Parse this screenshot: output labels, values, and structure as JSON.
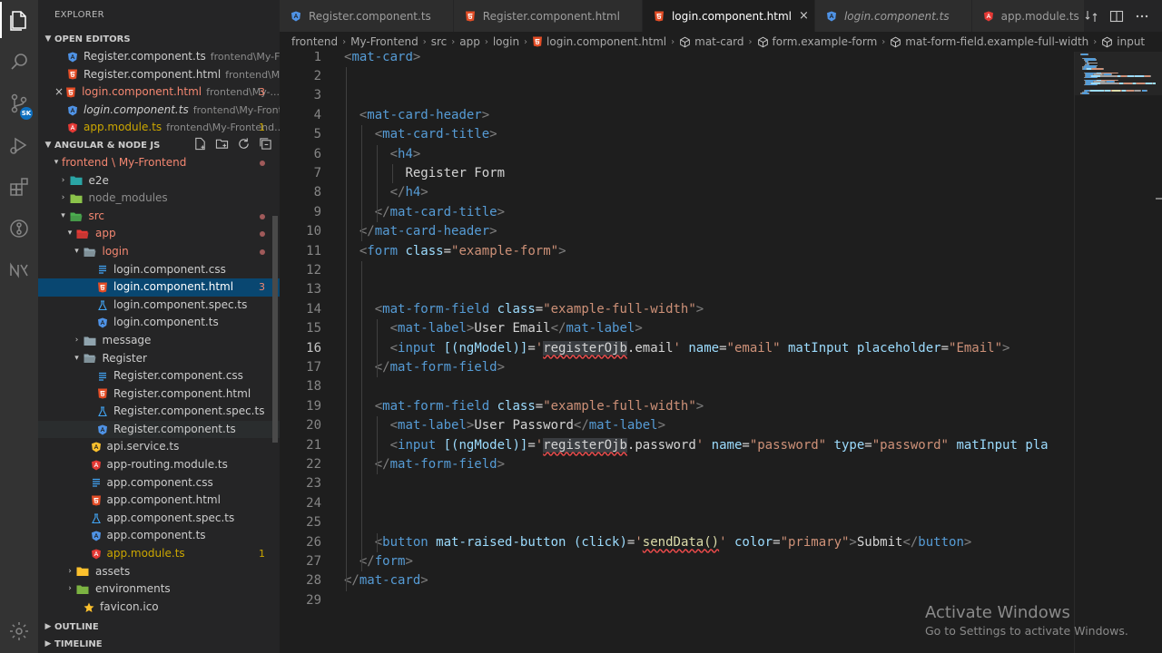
{
  "sidebar": {
    "title": "EXPLORER",
    "open_editors_header": "OPEN EDITORS",
    "open_editors": [
      {
        "name": "Register.component.ts",
        "path": "frontend\\My-Front...",
        "icon": "angular-ts-icon",
        "italic": false
      },
      {
        "name": "Register.component.html",
        "path": "frontend\\My-Fr...",
        "icon": "html-icon",
        "italic": false
      },
      {
        "name": "login.component.html",
        "path": "frontend\\My-...",
        "icon": "html-icon",
        "italic": false,
        "count": "3",
        "error": true
      },
      {
        "name": "login.component.ts",
        "path": "frontend\\My-Frontend...",
        "icon": "angular-ts-icon",
        "italic": true
      },
      {
        "name": "app.module.ts",
        "path": "frontend\\My-Frontend...",
        "icon": "angular-icon",
        "italic": false,
        "count": "1",
        "warn": true
      }
    ],
    "workspace_header": "ANGULAR & NODE JS",
    "outline_header": "OUTLINE",
    "timeline_header": "TIMELINE",
    "tree": [
      {
        "name": "frontend \\ My-Frontend",
        "depth": 0,
        "kind": "folder-open",
        "color": "err",
        "dot": true
      },
      {
        "name": "e2e",
        "depth": 1,
        "kind": "folder",
        "icon_color": "#2aa5a5"
      },
      {
        "name": "node_modules",
        "depth": 1,
        "kind": "folder",
        "icon_color": "#8bc34a",
        "dim": true
      },
      {
        "name": "src",
        "depth": 1,
        "kind": "folder-open",
        "color": "err",
        "dot": true,
        "icon_color": "#4caf50"
      },
      {
        "name": "app",
        "depth": 2,
        "kind": "folder-open",
        "color": "err",
        "dot": true,
        "icon_color": "#e53935"
      },
      {
        "name": "login",
        "depth": 3,
        "kind": "folder-open",
        "color": "err",
        "dot": true,
        "icon_color": "#90a4ae"
      },
      {
        "name": "login.component.css",
        "depth": 4,
        "kind": "css"
      },
      {
        "name": "login.component.html",
        "depth": 4,
        "kind": "html",
        "selected": true,
        "count": "3",
        "color": "err"
      },
      {
        "name": "login.component.spec.ts",
        "depth": 4,
        "kind": "spec"
      },
      {
        "name": "login.component.ts",
        "depth": 4,
        "kind": "angular-ts"
      },
      {
        "name": "message",
        "depth": 3,
        "kind": "folder",
        "icon_color": "#90a4ae"
      },
      {
        "name": "Register",
        "depth": 3,
        "kind": "folder-open",
        "icon_color": "#90a4ae"
      },
      {
        "name": "Register.component.css",
        "depth": 4,
        "kind": "css"
      },
      {
        "name": "Register.component.html",
        "depth": 4,
        "kind": "html"
      },
      {
        "name": "Register.component.spec.ts",
        "depth": 4,
        "kind": "spec"
      },
      {
        "name": "Register.component.ts",
        "depth": 4,
        "kind": "angular-ts",
        "hover": true
      },
      {
        "name": "api.service.ts",
        "depth": 3,
        "kind": "service"
      },
      {
        "name": "app-routing.module.ts",
        "depth": 3,
        "kind": "angular"
      },
      {
        "name": "app.component.css",
        "depth": 3,
        "kind": "css"
      },
      {
        "name": "app.component.html",
        "depth": 3,
        "kind": "html"
      },
      {
        "name": "app.component.spec.ts",
        "depth": 3,
        "kind": "spec"
      },
      {
        "name": "app.component.ts",
        "depth": 3,
        "kind": "angular-ts"
      },
      {
        "name": "app.module.ts",
        "depth": 3,
        "kind": "angular",
        "color": "warn",
        "count": "1"
      },
      {
        "name": "assets",
        "depth": 2,
        "kind": "folder",
        "icon_color": "#fbc02d"
      },
      {
        "name": "environments",
        "depth": 2,
        "kind": "folder",
        "icon_color": "#7cb342"
      },
      {
        "name": "favicon.ico",
        "depth": 2,
        "kind": "favicon"
      }
    ]
  },
  "tabs": [
    {
      "label": "Register.component.ts",
      "icon": "angular-ts-icon",
      "active": false,
      "italic": false
    },
    {
      "label": "Register.component.html",
      "icon": "html-icon",
      "active": false,
      "italic": false
    },
    {
      "label": "login.component.html",
      "icon": "html-icon",
      "active": true,
      "italic": false,
      "close": "×"
    },
    {
      "label": "login.component.ts",
      "icon": "angular-ts-icon",
      "active": false,
      "italic": true
    },
    {
      "label": "app.module.ts",
      "icon": "angular-icon",
      "active": false,
      "italic": false
    }
  ],
  "breadcrumb": [
    "frontend",
    "My-Frontend",
    "src",
    "app",
    "login",
    "login.component.html",
    "mat-card",
    "form.example-form",
    "mat-form-field.example-full-width",
    "input"
  ],
  "editor": {
    "lines": [
      [
        [
          "br",
          "<"
        ],
        [
          "tg",
          "mat-card"
        ],
        [
          "br",
          ">"
        ]
      ],
      [],
      [],
      [
        [
          "sp",
          "  "
        ],
        [
          "br",
          "<"
        ],
        [
          "tg",
          "mat-card-header"
        ],
        [
          "br",
          ">"
        ]
      ],
      [
        [
          "sp",
          "    "
        ],
        [
          "br",
          "<"
        ],
        [
          "tg",
          "mat-card-title"
        ],
        [
          "br",
          ">"
        ]
      ],
      [
        [
          "sp",
          "      "
        ],
        [
          "br",
          "<"
        ],
        [
          "tg",
          "h4"
        ],
        [
          "br",
          ">"
        ]
      ],
      [
        [
          "sp",
          "        "
        ],
        [
          "tx",
          "Register Form"
        ]
      ],
      [
        [
          "sp",
          "      "
        ],
        [
          "br",
          "</"
        ],
        [
          "tg",
          "h4"
        ],
        [
          "br",
          ">"
        ]
      ],
      [
        [
          "sp",
          "    "
        ],
        [
          "br",
          "</"
        ],
        [
          "tg",
          "mat-card-title"
        ],
        [
          "br",
          ">"
        ]
      ],
      [
        [
          "sp",
          "  "
        ],
        [
          "br",
          "</"
        ],
        [
          "tg",
          "mat-card-header"
        ],
        [
          "br",
          ">"
        ]
      ],
      [
        [
          "sp",
          "  "
        ],
        [
          "br",
          "<"
        ],
        [
          "tg",
          "form"
        ],
        [
          "tx",
          " "
        ],
        [
          "at",
          "class"
        ],
        [
          "tx",
          "="
        ],
        [
          "st",
          "\"example-form\""
        ],
        [
          "br",
          ">"
        ]
      ],
      [],
      [],
      [
        [
          "sp",
          "    "
        ],
        [
          "br",
          "<"
        ],
        [
          "tg",
          "mat-form-field"
        ],
        [
          "tx",
          " "
        ],
        [
          "at",
          "class"
        ],
        [
          "tx",
          "="
        ],
        [
          "st",
          "\"example-full-width\""
        ],
        [
          "br",
          ">"
        ]
      ],
      [
        [
          "sp",
          "      "
        ],
        [
          "br",
          "<"
        ],
        [
          "tg",
          "mat-label"
        ],
        [
          "br",
          ">"
        ],
        [
          "tx",
          "User Email"
        ],
        [
          "br",
          "</"
        ],
        [
          "tg",
          "mat-label"
        ],
        [
          "br",
          ">"
        ]
      ],
      [
        [
          "sp",
          "      "
        ],
        [
          "br",
          "<"
        ],
        [
          "tg",
          "input"
        ],
        [
          "tx",
          " "
        ],
        [
          "at",
          "[(ngModel)]"
        ],
        [
          "tx",
          "="
        ],
        [
          "st",
          "'"
        ],
        [
          "sqhl",
          "registerOjb"
        ],
        [
          "tx",
          ".email"
        ],
        [
          "st",
          "'"
        ],
        [
          "tx",
          " "
        ],
        [
          "at",
          "name"
        ],
        [
          "tx",
          "="
        ],
        [
          "st",
          "\"email\""
        ],
        [
          "tx",
          " "
        ],
        [
          "at",
          "matInput"
        ],
        [
          "tx",
          " "
        ],
        [
          "at",
          "placeholder"
        ],
        [
          "tx",
          "="
        ],
        [
          "st",
          "\"Email\""
        ],
        [
          "br",
          ">"
        ]
      ],
      [
        [
          "sp",
          "    "
        ],
        [
          "br",
          "</"
        ],
        [
          "tg",
          "mat-form-field"
        ],
        [
          "br",
          ">"
        ]
      ],
      [],
      [
        [
          "sp",
          "    "
        ],
        [
          "br",
          "<"
        ],
        [
          "tg",
          "mat-form-field"
        ],
        [
          "tx",
          " "
        ],
        [
          "at",
          "class"
        ],
        [
          "tx",
          "="
        ],
        [
          "st",
          "\"example-full-width\""
        ],
        [
          "br",
          ">"
        ]
      ],
      [
        [
          "sp",
          "      "
        ],
        [
          "br",
          "<"
        ],
        [
          "tg",
          "mat-label"
        ],
        [
          "br",
          ">"
        ],
        [
          "tx",
          "User Password"
        ],
        [
          "br",
          "</"
        ],
        [
          "tg",
          "mat-label"
        ],
        [
          "br",
          ">"
        ]
      ],
      [
        [
          "sp",
          "      "
        ],
        [
          "br",
          "<"
        ],
        [
          "tg",
          "input"
        ],
        [
          "tx",
          " "
        ],
        [
          "at",
          "[(ngModel)]"
        ],
        [
          "tx",
          "="
        ],
        [
          "st",
          "'"
        ],
        [
          "sqhl",
          "registerOjb"
        ],
        [
          "tx",
          ".password"
        ],
        [
          "st",
          "'"
        ],
        [
          "tx",
          " "
        ],
        [
          "at",
          "name"
        ],
        [
          "tx",
          "="
        ],
        [
          "st",
          "\"password\""
        ],
        [
          "tx",
          " "
        ],
        [
          "at",
          "type"
        ],
        [
          "tx",
          "="
        ],
        [
          "st",
          "\"password\""
        ],
        [
          "tx",
          " "
        ],
        [
          "at",
          "matInput"
        ],
        [
          "tx",
          " "
        ],
        [
          "at",
          "pla"
        ]
      ],
      [
        [
          "sp",
          "    "
        ],
        [
          "br",
          "</"
        ],
        [
          "tg",
          "mat-form-field"
        ],
        [
          "br",
          ">"
        ]
      ],
      [],
      [],
      [],
      [
        [
          "sp",
          "    "
        ],
        [
          "br",
          "<"
        ],
        [
          "tg",
          "button"
        ],
        [
          "tx",
          " "
        ],
        [
          "at",
          "mat-raised-button"
        ],
        [
          "tx",
          " "
        ],
        [
          "at",
          "(click)"
        ],
        [
          "tx",
          "="
        ],
        [
          "st",
          "'"
        ],
        [
          "fnsq",
          "sendData()"
        ],
        [
          "st",
          "'"
        ],
        [
          "tx",
          " "
        ],
        [
          "at",
          "color"
        ],
        [
          "tx",
          "="
        ],
        [
          "st",
          "\"primary\""
        ],
        [
          "br",
          ">"
        ],
        [
          "tx",
          "Submit"
        ],
        [
          "br",
          "</"
        ],
        [
          "tg",
          "button"
        ],
        [
          "br",
          ">"
        ]
      ],
      [
        [
          "sp",
          "  "
        ],
        [
          "br",
          "</"
        ],
        [
          "tg",
          "form"
        ],
        [
          "br",
          ">"
        ]
      ],
      [
        [
          "br",
          "</"
        ],
        [
          "tg",
          "mat-card"
        ],
        [
          "br",
          ">"
        ]
      ],
      []
    ]
  },
  "watermark": {
    "title": "Activate Windows",
    "subtitle": "Go to Settings to activate Windows."
  },
  "colors": {
    "accent": "#007acc",
    "error": "#f48771",
    "warning": "#cca700",
    "selection": "#094771"
  }
}
